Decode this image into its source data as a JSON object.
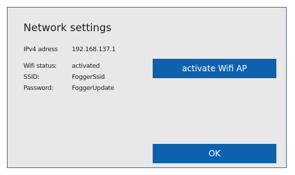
{
  "dialog": {
    "title": "Network settings",
    "ipv4": {
      "label": "IPv4 adress",
      "value": "192.168.137.1"
    },
    "wifi_status": {
      "label": "Wifi status:",
      "value": "activated"
    },
    "ssid": {
      "label": "SSID:",
      "value": "FoggerSsid"
    },
    "password": {
      "label": "Password:",
      "value": "FoggerUpdate"
    },
    "activate_ap_label": "activate Wifi AP",
    "ok_label": "OK"
  },
  "colors": {
    "dialog_background": "#e8e8e8",
    "dialog_border": "#5a6f86",
    "button_background": "#0d62b0",
    "button_text": "#ffffff"
  }
}
